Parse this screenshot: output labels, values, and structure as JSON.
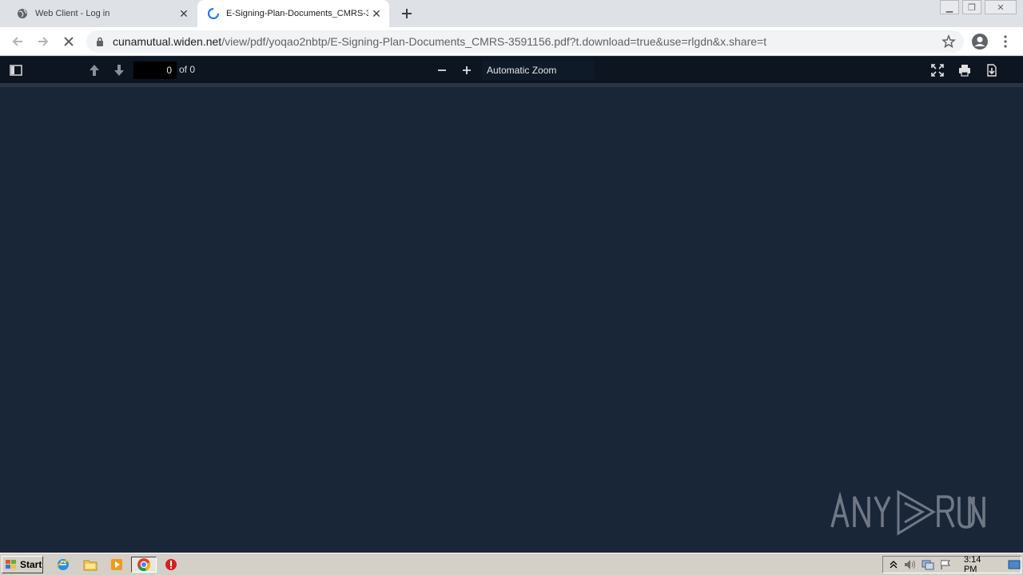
{
  "tabs": [
    {
      "title": "Web Client - Log in",
      "active": false,
      "icon": "globe-icon"
    },
    {
      "title": "E-Signing-Plan-Documents_CMRS-3591156.pdf",
      "active": true,
      "icon": "loading-spinner-icon"
    }
  ],
  "address_bar": {
    "host": "cunamutual.widen.net",
    "path": "/view/pdf/yoqao2nbtp/E-Signing-Plan-Documents_CMRS-3591156.pdf?t.download=true&use=rlgdn&x.share=t"
  },
  "pdf_toolbar": {
    "page_number": "0",
    "page_count": "of 0",
    "zoom": "Automatic Zoom"
  },
  "taskbar": {
    "start_label": "Start",
    "clock": "3:14 PM"
  },
  "colors": {
    "viewer_background": "#192637",
    "pdf_toolbar": "#0d1521",
    "tab_strip": "#dee1e6",
    "spinner": "#1a73e8"
  }
}
